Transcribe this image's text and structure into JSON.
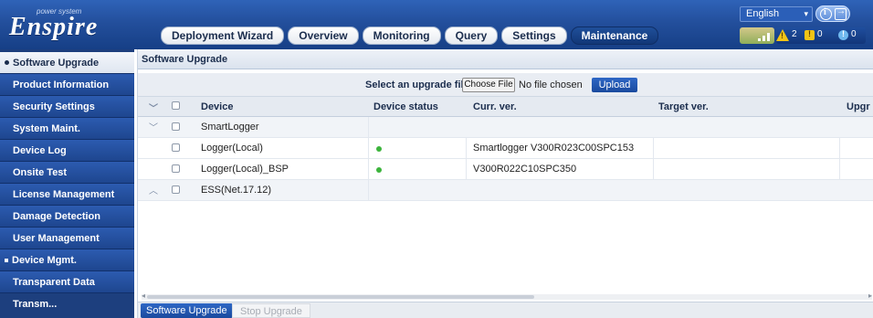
{
  "brand": {
    "tagline": "power system",
    "name": "Enspire"
  },
  "header": {
    "language": "English",
    "alarms": {
      "major": "2",
      "minor": "0",
      "warning": "0"
    }
  },
  "tabs": [
    {
      "label": "Deployment Wizard"
    },
    {
      "label": "Overview"
    },
    {
      "label": "Monitoring"
    },
    {
      "label": "Query"
    },
    {
      "label": "Settings"
    },
    {
      "label": "Maintenance",
      "active": true
    }
  ],
  "sidebar": {
    "items": [
      {
        "label": "Software Upgrade",
        "active": true
      },
      {
        "label": "Product Information"
      },
      {
        "label": "Security Settings"
      },
      {
        "label": "System Maint."
      },
      {
        "label": "Device Log"
      },
      {
        "label": "Onsite Test"
      },
      {
        "label": "License Management"
      },
      {
        "label": "Damage Detection"
      },
      {
        "label": "User Management"
      },
      {
        "label": "Device Mgmt."
      },
      {
        "label": "Transparent Data Transm..."
      }
    ]
  },
  "main": {
    "title": "Software Upgrade",
    "upload": {
      "label": "Select an upgrade file:",
      "choose_button": "Choose File",
      "file_status": "No file chosen",
      "upload_button": "Upload"
    },
    "table": {
      "columns": [
        "Device",
        "Device status",
        "Curr. ver.",
        "Target ver.",
        "Upgr"
      ],
      "rows": [
        {
          "device": "SmartLogger",
          "group": true,
          "expanded": true,
          "status": "",
          "curr": "",
          "target": ""
        },
        {
          "device": "Logger(Local)",
          "group": false,
          "status": "online",
          "curr": "Smartlogger V300R023C00SPC153",
          "target": ""
        },
        {
          "device": "Logger(Local)_BSP",
          "group": false,
          "status": "online",
          "curr": "V300R022C10SPC350",
          "target": ""
        },
        {
          "device": "ESS(Net.17.12)",
          "group": true,
          "expanded": false,
          "status": "",
          "curr": "",
          "target": ""
        }
      ]
    },
    "bottom": {
      "upgrade_button": "Software Upgrade",
      "stop_button": "Stop Upgrade"
    }
  },
  "colors": {
    "header": "#234f9c",
    "sidebar": "#1e468f",
    "accent": "#1a4a9e",
    "online": "#3cb43c"
  }
}
